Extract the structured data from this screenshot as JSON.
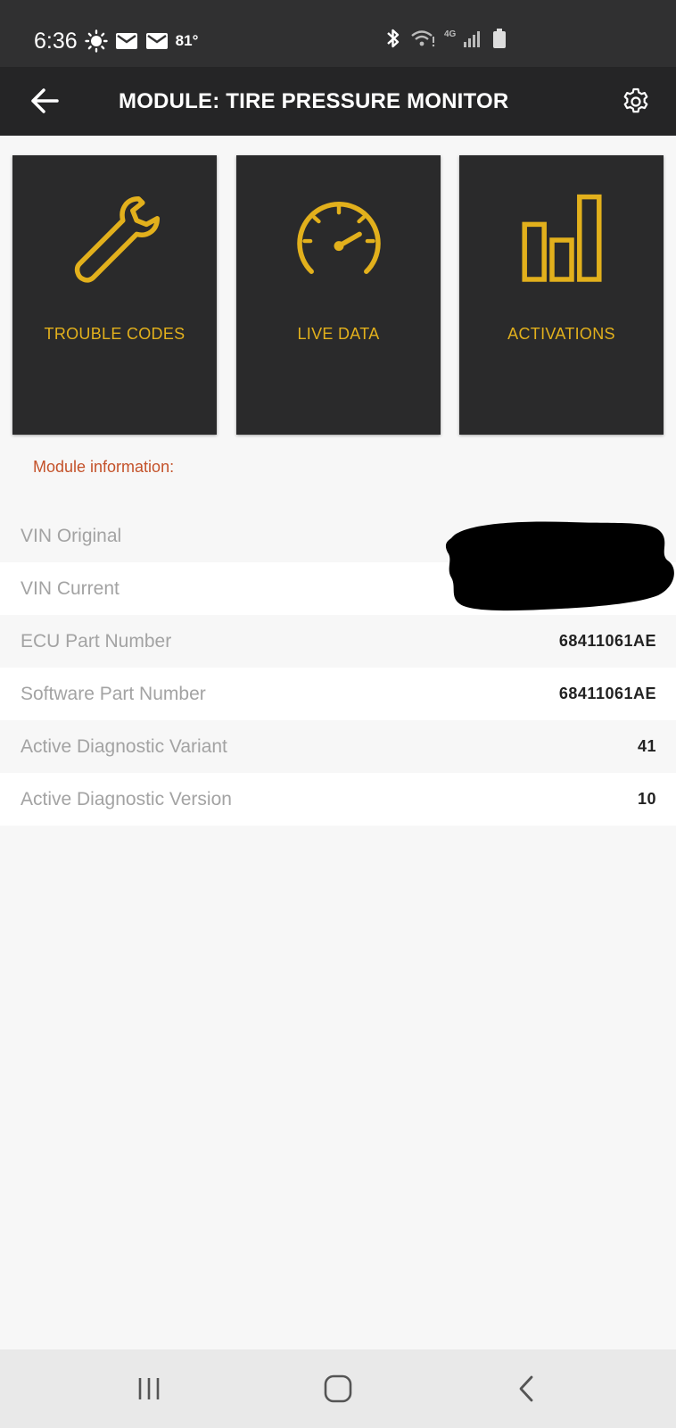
{
  "status_bar": {
    "time": "6:36",
    "temperature": "81°",
    "network": "4G"
  },
  "app_bar": {
    "title": "MODULE: TIRE PRESSURE MONITOR"
  },
  "tiles": [
    {
      "label": "TROUBLE CODES",
      "icon": "wrench-icon"
    },
    {
      "label": "LIVE DATA",
      "icon": "speedometer-icon"
    },
    {
      "label": "ACTIVATIONS",
      "icon": "bar-chart-icon"
    }
  ],
  "module_info": {
    "heading": "Module information:",
    "rows": [
      {
        "label": "VIN Original",
        "value": ""
      },
      {
        "label": "VIN Current",
        "value": ""
      },
      {
        "label": "ECU Part Number",
        "value": "68411061AE"
      },
      {
        "label": "Software Part Number",
        "value": "68411061AE"
      },
      {
        "label": "Active Diagnostic Variant",
        "value": "41"
      },
      {
        "label": "Active Diagnostic Version",
        "value": "10"
      }
    ]
  },
  "colors": {
    "accent": "#e2b01c",
    "heading": "#c4522a",
    "tile_bg": "#2a2a2b",
    "app_bar": "#252526"
  }
}
